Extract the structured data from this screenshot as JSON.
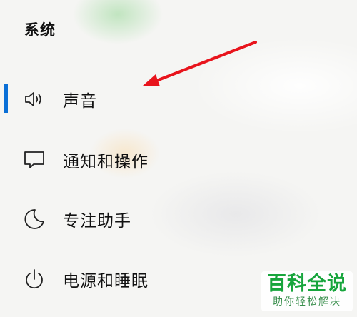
{
  "section": {
    "title": "系统"
  },
  "nav": {
    "items": [
      {
        "label": "声音",
        "icon": "speaker-icon",
        "selected": true
      },
      {
        "label": "通知和操作",
        "icon": "message-icon",
        "selected": false
      },
      {
        "label": "专注助手",
        "icon": "moon-icon",
        "selected": false
      },
      {
        "label": "电源和睡眠",
        "icon": "power-icon",
        "selected": false
      }
    ]
  },
  "colors": {
    "accent": "#0a6fd6",
    "arrow": "#e8141c",
    "watermark": "#17a53c"
  },
  "watermark": {
    "main": "百科全说",
    "sub": "助你轻松解决"
  }
}
